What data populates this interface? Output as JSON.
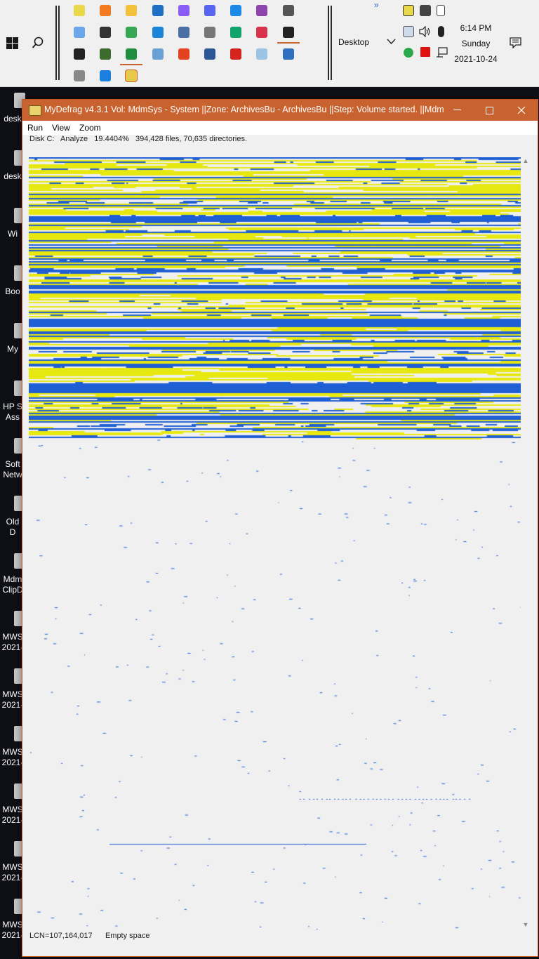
{
  "taskbar": {
    "search_icon": "search-icon",
    "pinned_rows": [
      [
        "xwin-icon",
        "firefox-icon",
        "file-explorer-icon",
        "outlook-icon",
        "messenger-icon",
        "discord-icon",
        "vscode-icon",
        "visual-studio-icon",
        "gimp-icon"
      ],
      [
        "windows-legacy-icon",
        "camera-icon",
        "chrome-icon",
        "app-grid-icon",
        "network-monitor-icon",
        "settings-icon",
        "green-app-icon",
        "robot-app-icon",
        "cmd-icon"
      ],
      [
        "cmd-icon",
        "tree-icon",
        "excel-qr-icon",
        "photo-viewer-icon",
        "office-icon",
        "word-icon",
        "acrobat-icon",
        "notepad-icon",
        "document-icon"
      ],
      [
        "clock-check-icon",
        "todo-check-icon",
        "mydefrag-icon"
      ]
    ],
    "toolbar_label": "Desktop",
    "toolbar_chevron": "chevron-down-icon",
    "overflow_label": "»",
    "clock": {
      "time": "6:14 PM",
      "day": "Sunday",
      "date": "2021-10-24"
    },
    "action_center_icon": "notification-icon"
  },
  "desktop_icons": [
    "desk",
    "desk",
    "Wi",
    "Boo",
    "My",
    "HP S\nAss",
    "Soft\nNetw",
    "Old\nD",
    "Mdm\nClipD",
    "MWS\n2021-",
    "MWS\n2021-",
    "MWS\n2021-",
    "MWS\n2021-",
    "MWS\n2021-",
    "MWS\n2021-"
  ],
  "window": {
    "title": "MyDefrag v4.3.1    Vol: MdmSys - System ||Zone: ArchivesBu - ArchivesBu ||Step: Volume started. ||Mdm!S...",
    "menu": [
      "Run",
      "View",
      "Zoom"
    ],
    "info": "Disk C:   Analyze   19.4404%   394,428 files, 70,635 directories.",
    "status": "LCN=107,164,017      Empty space",
    "colors": {
      "titlebar": "#c8622e",
      "used_blue": "#1f5fd6",
      "used_yellow": "#e8e811",
      "empty": "#f0f0f0"
    }
  }
}
